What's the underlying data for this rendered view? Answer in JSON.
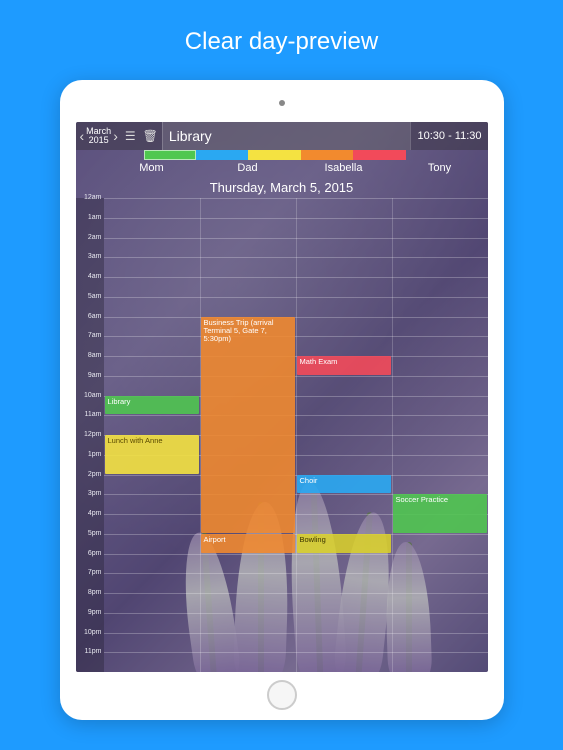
{
  "promo_title": "Clear day-preview",
  "nav": {
    "month": "March",
    "year": "2015"
  },
  "editing_event": {
    "title": "Library",
    "time_range": "10:30 - 11:30"
  },
  "swatches": [
    "green",
    "blue",
    "yellow",
    "orange",
    "red"
  ],
  "columns": [
    "Mom",
    "Dad",
    "Isabella",
    "Tony"
  ],
  "date_title": "Thursday, March 5, 2015",
  "hours": [
    "12am",
    "1am",
    "2am",
    "3am",
    "4am",
    "5am",
    "6am",
    "7am",
    "8am",
    "9am",
    "10am",
    "11am",
    "12pm",
    "1pm",
    "2pm",
    "3pm",
    "4pm",
    "5pm",
    "6pm",
    "7pm",
    "8pm",
    "9pm",
    "10pm",
    "11pm"
  ],
  "events": [
    {
      "col": 1,
      "start_idx": 6,
      "end_idx": 17,
      "color": "orange",
      "title": "Business Trip (arrival Terminal 5, Gate 7, 5:30pm)"
    },
    {
      "col": 2,
      "start_idx": 8,
      "end_idx": 9,
      "color": "red",
      "title": "Math Exam"
    },
    {
      "col": 0,
      "start_idx": 10,
      "end_idx": 11,
      "color": "green",
      "title": "Library"
    },
    {
      "col": 0,
      "start_idx": 12,
      "end_idx": 14,
      "color": "yellow",
      "title": "Lunch with Anne"
    },
    {
      "col": 2,
      "start_idx": 14,
      "end_idx": 15,
      "color": "blue",
      "title": "Choir"
    },
    {
      "col": 3,
      "start_idx": 15,
      "end_idx": 17,
      "color": "green",
      "title": "Soccer Practice"
    },
    {
      "col": 1,
      "start_idx": 17,
      "end_idx": 18,
      "color": "orange",
      "title": "Airport"
    },
    {
      "col": 2,
      "start_idx": 17,
      "end_idx": 18,
      "color": "yellow2",
      "title": "Bowling"
    }
  ]
}
